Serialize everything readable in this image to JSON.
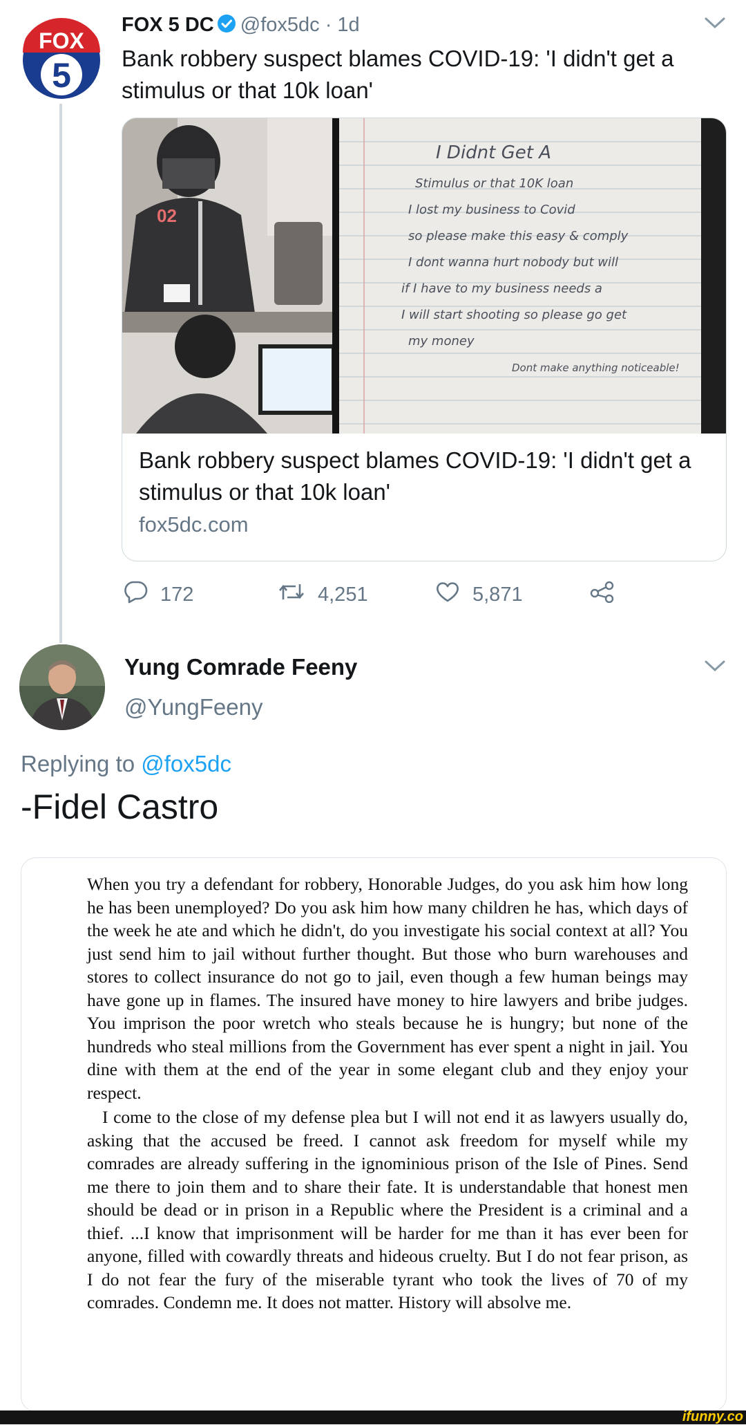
{
  "tweet": {
    "avatar_text": [
      "FOX",
      "5"
    ],
    "name": "FOX 5 DC",
    "handle": "@fox5dc",
    "separator": " · ",
    "time": "1d",
    "text": "Bank robbery suspect blames COVID-19: 'I didn't get a stimulus or that 10k loan'",
    "card": {
      "note_lines": [
        "I Didnt Get A",
        "Stimulus or that 10K loan",
        "I lost my business to Covid",
        "so please make this easy & comply",
        "I dont wanna hurt nobody but will",
        "if I have to my business needs a",
        "I will start shooting so please go get",
        "my money",
        "Dont make anything noticeable!"
      ],
      "title": "Bank robbery suspect blames COVID-19: 'I didn't get a stimulus or that 10k loan'",
      "domain": "fox5dc.com"
    },
    "actions": {
      "replies": "172",
      "retweets": "4,251",
      "likes": "5,871"
    }
  },
  "reply": {
    "name": "Yung Comrade Feeny",
    "handle": "@YungFeeny",
    "replying_prefix": "Replying to ",
    "replying_to": "@fox5dc",
    "text": "-Fidel Castro",
    "quote_paragraphs": [
      "When you try a defendant for robbery, Honorable Judges, do you ask him how long he has been unemployed? Do you ask him how many children he has, which days of the week he ate and which he didn't, do you investigate his social context at all? You just send him to jail without further thought. But those who burn warehouses and stores to collect insurance do not go to jail, even though a few human beings may have gone up in flames. The insured have money to hire lawyers and bribe judges. You imprison the poor wretch who steals because he is hungry; but none of the hundreds who steal millions from the Government has ever spent a night in jail. You dine with them at the end of the year in some elegant club and they enjoy your respect.",
      "I come to the close of my defense plea but I will not end it as lawyers usually do, asking that the accused be freed. I cannot ask freedom for myself while my comrades are already suffering in the ignominious prison of the Isle of Pines. Send me there to join them and to share their fate. It is understandable that honest men should be dead or in prison in a Republic where the President is a criminal and a thief. ...I know that imprisonment will be harder for me than it has ever been for anyone, filled with cowardly threats and hideous cruelty. But I do not fear prison, as I do not fear the fury of the miserable tyrant who took the lives of 70 of my comrades. Condemn me. It does not matter. History will absolve me."
    ]
  },
  "watermark": "ifunny.co",
  "colors": {
    "accent": "#1da1f2",
    "secondary_text": "#657786",
    "primary_text": "#14171a"
  }
}
